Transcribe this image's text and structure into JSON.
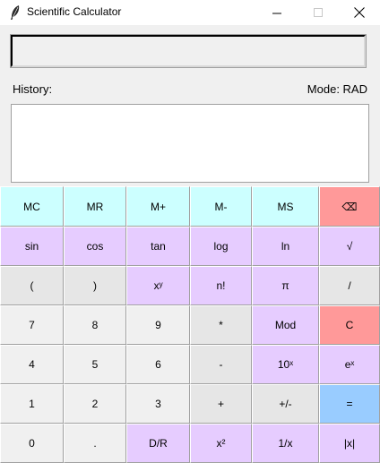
{
  "window": {
    "title": "Scientific Calculator",
    "minimize": "—",
    "maximize": "☐",
    "close": "✕"
  },
  "display": {
    "value": ""
  },
  "history": {
    "label": "History:",
    "entries": []
  },
  "mode": {
    "label": "Mode: RAD"
  },
  "colors": {
    "memory": "#ccffff",
    "function": "#e6ccff",
    "operator": "#e6e6e6",
    "digit": "#f0f0f0",
    "danger": "#ff9999",
    "equals": "#99ccff"
  },
  "keypad": {
    "rows": [
      [
        {
          "label": "MC",
          "name": "memory-clear-button",
          "color": "memory"
        },
        {
          "label": "MR",
          "name": "memory-recall-button",
          "color": "memory"
        },
        {
          "label": "M+",
          "name": "memory-add-button",
          "color": "memory"
        },
        {
          "label": "M-",
          "name": "memory-subtract-button",
          "color": "memory"
        },
        {
          "label": "MS",
          "name": "memory-store-button",
          "color": "memory"
        },
        {
          "label": "⌫",
          "name": "backspace-button",
          "color": "danger"
        }
      ],
      [
        {
          "label": "sin",
          "name": "sin-button",
          "color": "function"
        },
        {
          "label": "cos",
          "name": "cos-button",
          "color": "function"
        },
        {
          "label": "tan",
          "name": "tan-button",
          "color": "function"
        },
        {
          "label": "log",
          "name": "log-button",
          "color": "function"
        },
        {
          "label": "ln",
          "name": "ln-button",
          "color": "function"
        },
        {
          "label": "√",
          "name": "sqrt-button",
          "color": "function"
        }
      ],
      [
        {
          "label": "(",
          "name": "open-paren-button",
          "color": "operator"
        },
        {
          "label": ")",
          "name": "close-paren-button",
          "color": "operator"
        },
        {
          "label": "xʸ",
          "name": "power-button",
          "color": "function"
        },
        {
          "label": "n!",
          "name": "factorial-button",
          "color": "function"
        },
        {
          "label": "π",
          "name": "pi-button",
          "color": "function"
        },
        {
          "label": "/",
          "name": "divide-button",
          "color": "operator"
        }
      ],
      [
        {
          "label": "7",
          "name": "digit-7-button",
          "color": "digit"
        },
        {
          "label": "8",
          "name": "digit-8-button",
          "color": "digit"
        },
        {
          "label": "9",
          "name": "digit-9-button",
          "color": "digit"
        },
        {
          "label": "*",
          "name": "multiply-button",
          "color": "operator"
        },
        {
          "label": "Mod",
          "name": "mod-button",
          "color": "function"
        },
        {
          "label": "C",
          "name": "clear-button",
          "color": "danger"
        }
      ],
      [
        {
          "label": "4",
          "name": "digit-4-button",
          "color": "digit"
        },
        {
          "label": "5",
          "name": "digit-5-button",
          "color": "digit"
        },
        {
          "label": "6",
          "name": "digit-6-button",
          "color": "digit"
        },
        {
          "label": "-",
          "name": "subtract-button",
          "color": "operator"
        },
        {
          "label": "10ˣ",
          "name": "ten-power-button",
          "color": "function"
        },
        {
          "label": "eˣ",
          "name": "exp-button",
          "color": "function"
        }
      ],
      [
        {
          "label": "1",
          "name": "digit-1-button",
          "color": "digit"
        },
        {
          "label": "2",
          "name": "digit-2-button",
          "color": "digit"
        },
        {
          "label": "3",
          "name": "digit-3-button",
          "color": "digit"
        },
        {
          "label": "+",
          "name": "add-button",
          "color": "operator"
        },
        {
          "label": "+/-",
          "name": "negate-button",
          "color": "operator"
        },
        {
          "label": "=",
          "name": "equals-button",
          "color": "equals"
        }
      ],
      [
        {
          "label": "0",
          "name": "digit-0-button",
          "color": "digit"
        },
        {
          "label": ".",
          "name": "decimal-button",
          "color": "digit"
        },
        {
          "label": "D/R",
          "name": "deg-rad-toggle-button",
          "color": "function"
        },
        {
          "label": "x²",
          "name": "square-button",
          "color": "function"
        },
        {
          "label": "1/x",
          "name": "reciprocal-button",
          "color": "function"
        },
        {
          "label": "|x|",
          "name": "abs-button",
          "color": "function"
        }
      ]
    ]
  }
}
